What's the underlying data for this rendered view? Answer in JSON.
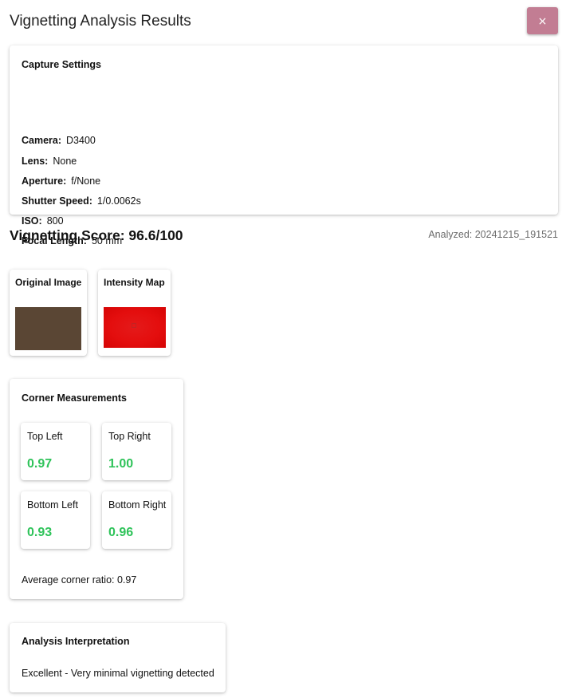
{
  "header": {
    "title": "Vignetting Analysis Results",
    "close_label": "×"
  },
  "capture_settings": {
    "title": "Capture Settings",
    "rows": [
      {
        "key": "Camera:",
        "value": "D3400"
      },
      {
        "key": "Lens:",
        "value": "None"
      },
      {
        "key": "Aperture:",
        "value": "f/None"
      },
      {
        "key": "Shutter Speed:",
        "value": "1/0.0062s"
      },
      {
        "key": "ISO:",
        "value": "800"
      },
      {
        "key": "Focal Length:",
        "value": "50 mm"
      }
    ]
  },
  "score": {
    "label": "Vignetting Score: 96.6/100",
    "analyzed": "Analyzed: 20241215_191521"
  },
  "images": {
    "original_title": "Original Image",
    "intensity_title": "Intensity Map"
  },
  "corners": {
    "title": "Corner Measurements",
    "items": [
      {
        "label": "Top Left",
        "value": "0.97"
      },
      {
        "label": "Top Right",
        "value": "1.00"
      },
      {
        "label": "Bottom Left",
        "value": "0.93"
      },
      {
        "label": "Bottom Right",
        "value": "0.96"
      }
    ],
    "average": "Average corner ratio: 0.97"
  },
  "interpretation": {
    "title": "Analysis Interpretation",
    "text": "Excellent - Very minimal vignetting detected"
  },
  "colors": {
    "accent_button": "#c27d93",
    "good_value": "#2fc35a"
  }
}
